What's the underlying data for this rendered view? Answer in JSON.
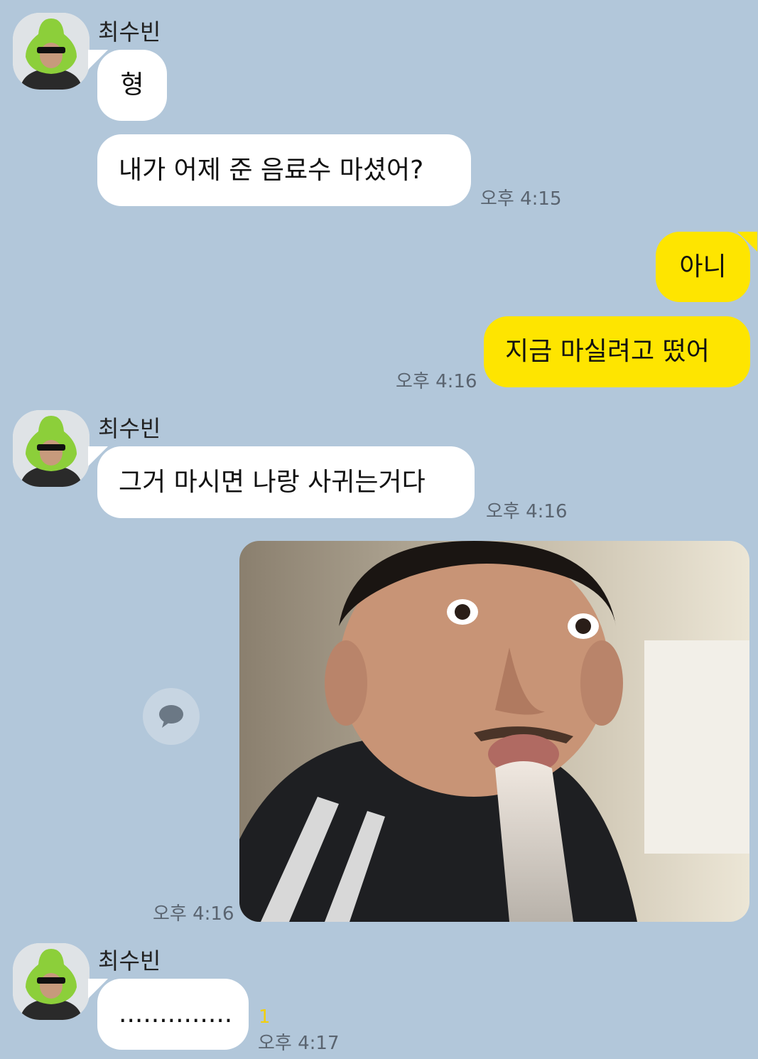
{
  "chat": {
    "sender_name": "최수빈",
    "messages": [
      {
        "text": "형"
      },
      {
        "text": "내가 어제 준 음료수 마셨어?",
        "time": "오후 4:15"
      },
      {
        "text": "아니"
      },
      {
        "text": "지금 마실려고 떴어",
        "time": "오후 4:16"
      },
      {
        "text": "그거 마시면 나랑 사귀는거다",
        "time": "오후 4:16"
      },
      {
        "time": "오후 4:16"
      },
      {
        "text": "..............",
        "time": "오후 4:17",
        "unread": "1"
      }
    ]
  },
  "colors": {
    "background": "#b2c7da",
    "incoming_bubble": "#ffffff",
    "outgoing_bubble": "#fee500",
    "unread_count": "#f2cf0c"
  },
  "icons": {
    "share": "speech-bubble-icon"
  }
}
